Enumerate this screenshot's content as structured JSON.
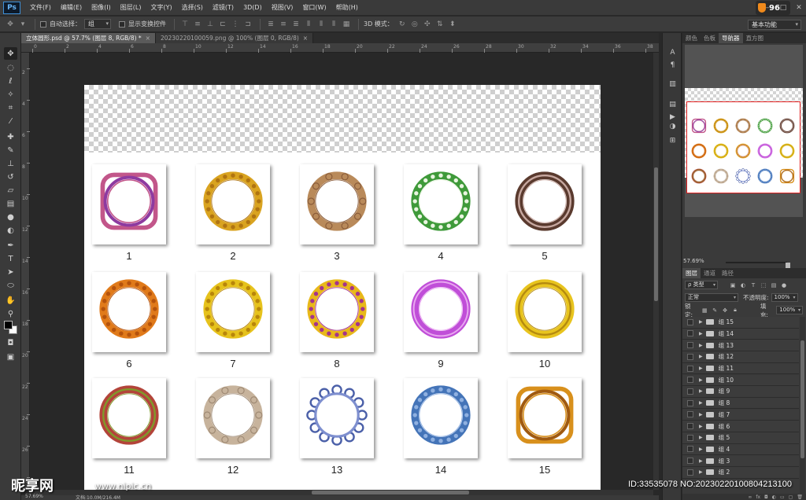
{
  "app": {
    "logo": "Ps",
    "menus": [
      "文件(F)",
      "编辑(E)",
      "图像(I)",
      "图层(L)",
      "文字(Y)",
      "选择(S)",
      "滤镜(T)",
      "3D(D)",
      "视图(V)",
      "窗口(W)",
      "帮助(H)"
    ],
    "speed_value": "96",
    "window_controls": [
      "minimize-icon",
      "restore-icon",
      "close-icon"
    ]
  },
  "options": {
    "auto_select_label": "自动选择：",
    "auto_select_value": "组",
    "show_transform_label": "显示变换控件",
    "mode_3d_label": "3D 模式：",
    "workspace": "基本功能"
  },
  "tabs": [
    {
      "label": "立体圆形.psd @ 57.7% (图层 8, RGB/8) *",
      "active": true
    },
    {
      "label": "20230220100059.png @ 100% (图层 0, RGB/8)",
      "active": false
    }
  ],
  "rulers": {
    "top_ticks": [
      "0",
      "2",
      "4",
      "6",
      "8",
      "10",
      "12",
      "14",
      "16",
      "18",
      "20",
      "22",
      "24",
      "26",
      "28",
      "30",
      "32",
      "34",
      "36",
      "38"
    ],
    "left_ticks": [
      "2",
      "4",
      "6",
      "8",
      "10",
      "12",
      "14",
      "16",
      "18",
      "20",
      "22",
      "24",
      "26",
      "28"
    ]
  },
  "frames": [
    {
      "label": "1",
      "color": "#c2568a",
      "accent": "#8e3aa0",
      "style": "ornate"
    },
    {
      "label": "2",
      "color": "#d9a320",
      "accent": "#b07412",
      "style": "beaded"
    },
    {
      "label": "3",
      "color": "#b98a5a",
      "accent": "#8a5c3a",
      "style": "filigree"
    },
    {
      "label": "4",
      "color": "#3f9a3a",
      "accent": "#e9f5e0",
      "style": "studded"
    },
    {
      "label": "5",
      "color": "#5a3a2e",
      "accent": "#c7a8a0",
      "style": "double"
    },
    {
      "label": "6",
      "color": "#e07a1a",
      "accent": "#b5530c",
      "style": "beaded"
    },
    {
      "label": "7",
      "color": "#e6c21c",
      "accent": "#b8860b",
      "style": "studded"
    },
    {
      "label": "8",
      "color": "#e8b81a",
      "accent": "#a4348c",
      "style": "beaded"
    },
    {
      "label": "9",
      "color": "#c04ed8",
      "accent": "#e8a6f0",
      "style": "smooth"
    },
    {
      "label": "10",
      "color": "#e8c41e",
      "accent": "#b48a10",
      "style": "double"
    },
    {
      "label": "11",
      "color": "#b3443a",
      "accent": "#7f9a2a",
      "style": "double"
    },
    {
      "label": "12",
      "color": "#c7b39c",
      "accent": "#9f8a74",
      "style": "filigree"
    },
    {
      "label": "13",
      "color": "#4a5fa8",
      "accent": "#7e8fcf",
      "style": "snowflake"
    },
    {
      "label": "14",
      "color": "#4474b8",
      "accent": "#8fb0e0",
      "style": "studded"
    },
    {
      "label": "15",
      "color": "#d8901c",
      "accent": "#a05a10",
      "style": "ornate"
    }
  ],
  "panels": {
    "top_tabs": [
      "颜色",
      "色板",
      "导航器",
      "直方图"
    ],
    "active_top_tab": "导航器",
    "nav_zoom": "57.69%",
    "layer_tabs": [
      "图层",
      "通道",
      "路径"
    ],
    "filter_kind": "ρ 类型",
    "blend_mode": "正常",
    "opacity_label": "不透明度:",
    "opacity_value": "100%",
    "lock_label": "锁定:",
    "fill_label": "填充:",
    "fill_value": "100%",
    "layers": [
      "组 15",
      "组 14",
      "组 13",
      "组 12",
      "组 11",
      "组 10",
      "组 9",
      "组 8",
      "组 7",
      "组 6",
      "组 5",
      "组 4",
      "组 3",
      "组 2"
    ]
  },
  "status": {
    "zoom": "57.69%",
    "doc_size": "文档:10.0M/216.4M"
  },
  "watermark": {
    "logo": "昵享网",
    "url": "www.nipic.cn",
    "id": "ID:33535078 NO:20230220100804213100"
  }
}
